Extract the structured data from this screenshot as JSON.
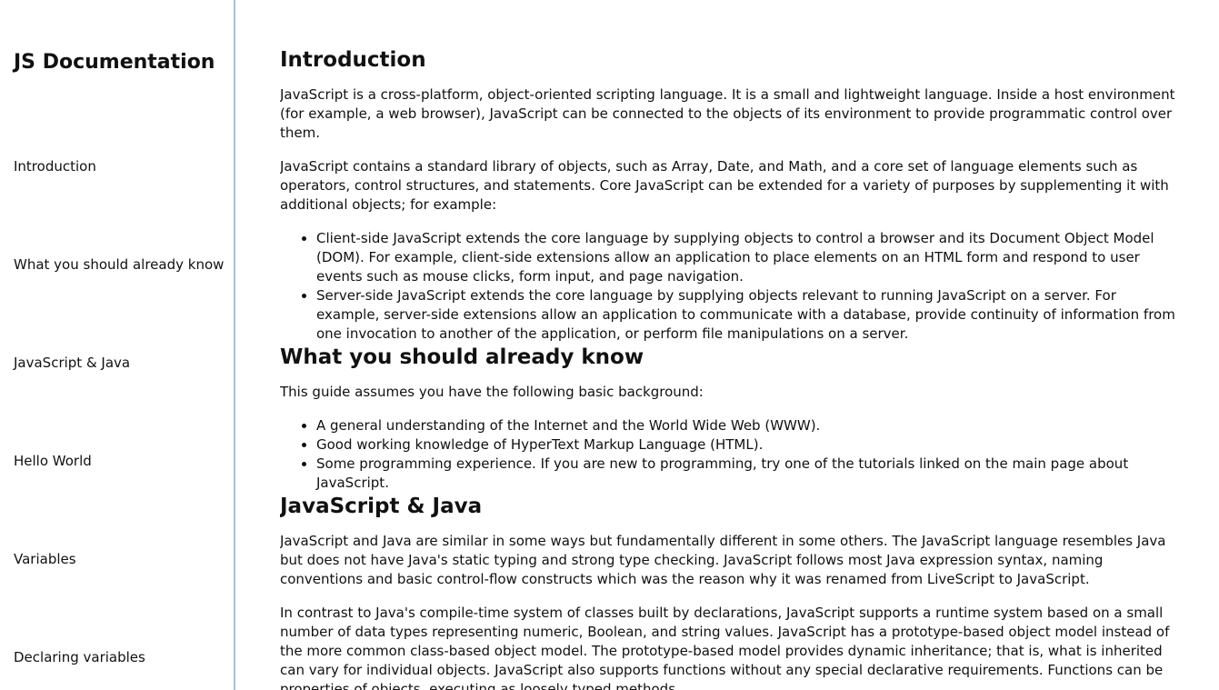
{
  "nav": {
    "title": "JS Documentation",
    "links": [
      "Introduction",
      "What you should already know",
      "JavaScript & Java",
      "Hello World",
      "Variables",
      "Declaring variables"
    ]
  },
  "sections": {
    "intro": {
      "heading": "Introduction",
      "p1": "JavaScript is a cross-platform, object-oriented scripting language. It is a small and lightweight language. Inside a host environment (for example, a web browser), JavaScript can be connected to the objects of its environment to provide programmatic control over them.",
      "p2": "JavaScript contains a standard library of objects, such as Array, Date, and Math, and a core set of language elements such as operators, control structures, and statements. Core JavaScript can be extended for a variety of purposes by supplementing it with additional objects; for example:",
      "items": [
        "Client-side JavaScript extends the core language by supplying objects to control a browser and its Document Object Model (DOM). For example, client-side extensions allow an application to place elements on an HTML form and respond to user events such as mouse clicks, form input, and page navigation.",
        "Server-side JavaScript extends the core language by supplying objects relevant to running JavaScript on a server. For example, server-side extensions allow an application to communicate with a database, provide continuity of information from one invocation to another of the application, or perform file manipulations on a server."
      ]
    },
    "know": {
      "heading": "What you should already know",
      "p1": "This guide assumes you have the following basic background:",
      "items": [
        "A general understanding of the Internet and the World Wide Web (WWW).",
        "Good working knowledge of HyperText Markup Language (HTML).",
        "Some programming experience. If you are new to programming, try one of the tutorials linked on the main page about JavaScript."
      ]
    },
    "java": {
      "heading": "JavaScript & Java",
      "p1": "JavaScript and Java are similar in some ways but fundamentally different in some others. The JavaScript language resembles Java but does not have Java's static typing and strong type checking. JavaScript follows most Java expression syntax, naming conventions and basic control-flow constructs which was the reason why it was renamed from LiveScript to JavaScript.",
      "p2": "In contrast to Java's compile-time system of classes built by declarations, JavaScript supports a runtime system based on a small number of data types representing numeric, Boolean, and string values. JavaScript has a prototype-based object model instead of the more common class-based object model. The prototype-based model provides dynamic inheritance; that is, what is inherited can vary for individual objects. JavaScript also supports functions without any special declarative requirements. Functions can be properties of objects, executing as loosely typed methods."
    }
  },
  "colors": {
    "nav_border": "#a9c0d8",
    "text": "#111111"
  }
}
